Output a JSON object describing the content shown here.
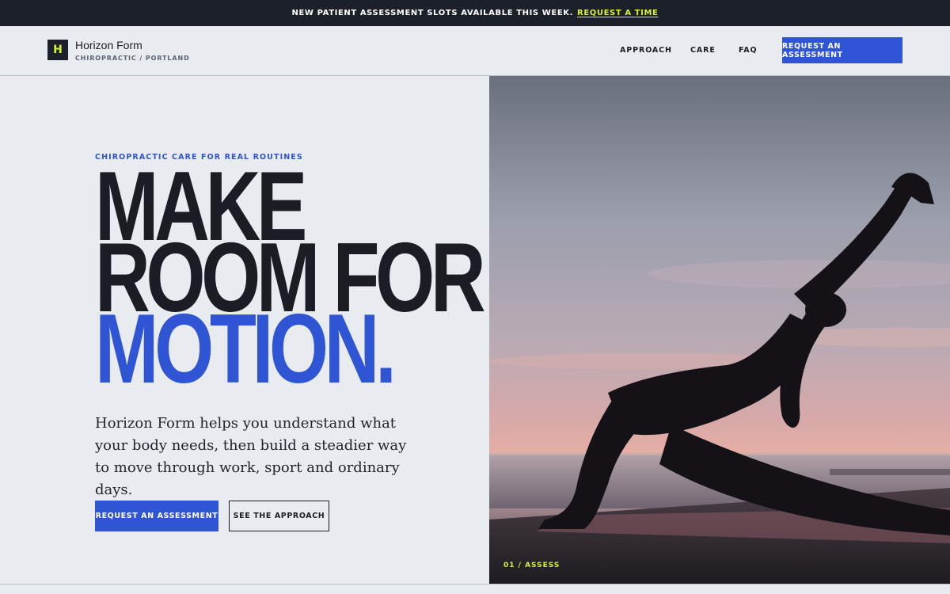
{
  "announcement": {
    "text": "NEW PATIENT ASSESSMENT SLOTS AVAILABLE THIS WEEK.",
    "link": "REQUEST A TIME"
  },
  "header": {
    "logo_letter": "H",
    "brand_name": "Horizon Form",
    "brand_sub": "CHIROPRACTIC / PORTLAND",
    "nav": [
      "APPROACH",
      "CARE",
      "FAQ"
    ],
    "cta": "REQUEST AN ASSESSMENT"
  },
  "hero": {
    "eyebrow": "CHIROPRACTIC CARE FOR REAL ROUTINES",
    "headline": [
      "MAKE",
      "ROOM FOR",
      "MOTION."
    ],
    "lede": "Horizon Form helps you understand what your body needs, then build a steadier way to move through work, sport and ordinary days.",
    "primary_button": "REQUEST AN ASSESSMENT",
    "secondary_button": "SEE THE APPROACH",
    "image_caption": "01 / ASSESS"
  },
  "colors": {
    "accent": "#2f55d4",
    "dark": "#1c202a",
    "highlight": "#d7f03a",
    "background": "#e8ebef"
  }
}
